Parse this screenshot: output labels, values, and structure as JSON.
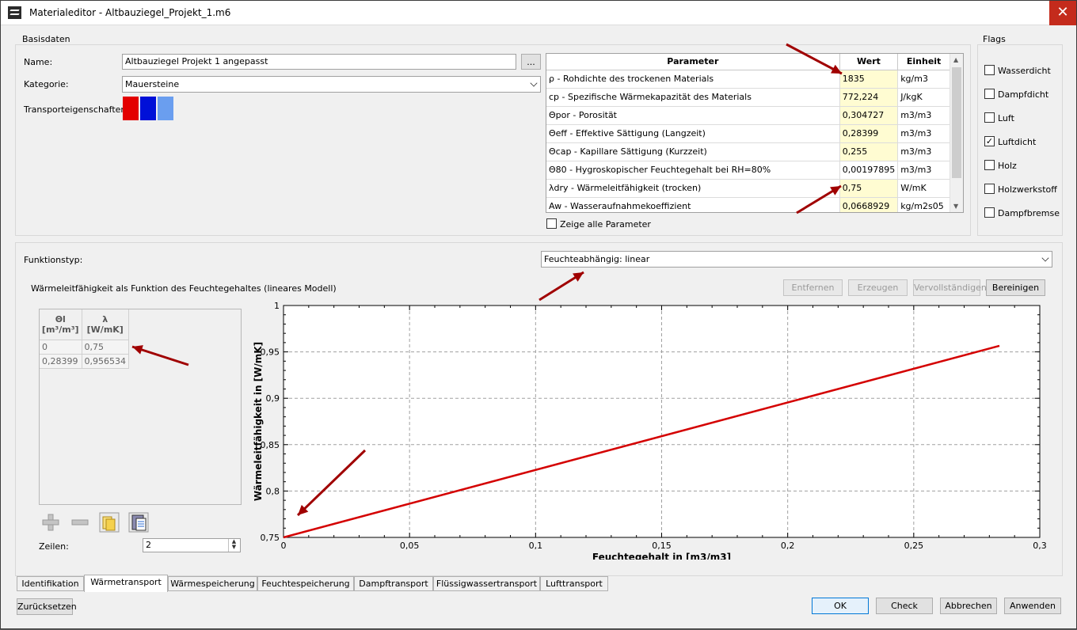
{
  "window": {
    "title": "Materialeditor - Altbauziegel_Projekt_1.m6",
    "close_glyph": "✕"
  },
  "basisdaten": {
    "group_label": "Basisdaten",
    "name_label": "Name:",
    "name_value": "Altbauziegel Projekt 1 angepasst",
    "browse_label": "...",
    "kategorie_label": "Kategorie:",
    "kategorie_value": "Mauersteine",
    "transport_label": "Transporteigenschaften:",
    "transport_colors": [
      "#e30000",
      "#0010d8",
      "#6a9eef"
    ]
  },
  "param_table": {
    "headers": {
      "param": "Parameter",
      "wert": "Wert",
      "einheit": "Einheit"
    },
    "rows": [
      {
        "param": "ρ - Rohdichte des trockenen Materials",
        "wert": "1835",
        "einheit": "kg/m3",
        "highlight": true
      },
      {
        "param": "cp - Spezifische Wärmekapazität des Materials",
        "wert": "772,224",
        "einheit": "J/kgK",
        "highlight": true
      },
      {
        "param": "Θpor - Porosität",
        "wert": "0,304727",
        "einheit": "m3/m3",
        "highlight": true
      },
      {
        "param": "Θeff - Effektive Sättigung (Langzeit)",
        "wert": "0,28399",
        "einheit": "m3/m3",
        "highlight": true
      },
      {
        "param": "Θcap - Kapillare Sättigung (Kurzzeit)",
        "wert": "0,255",
        "einheit": "m3/m3",
        "highlight": true
      },
      {
        "param": "Θ80 - Hygroskopischer Feuchtegehalt bei RH=80%",
        "wert": "0,00197895",
        "einheit": "m3/m3",
        "highlight": false
      },
      {
        "param": "λdry - Wärmeleitfähigkeit (trocken)",
        "wert": "0,75",
        "einheit": "W/mK",
        "highlight": true
      },
      {
        "param": "Aw - Wasseraufnahmekoeffizient",
        "wert": "0,0668929",
        "einheit": "kg/m2s05",
        "highlight": true
      }
    ],
    "show_all_label": "Zeige alle Parameter"
  },
  "flags": {
    "group_label": "Flags",
    "items": [
      {
        "label": "Wasserdicht",
        "checked": false
      },
      {
        "label": "Dampfdicht",
        "checked": false
      },
      {
        "label": "Luft",
        "checked": false
      },
      {
        "label": "Luftdicht",
        "checked": true
      },
      {
        "label": "Holz",
        "checked": false
      },
      {
        "label": "Holzwerkstoff",
        "checked": false
      },
      {
        "label": "Dampfbremse",
        "checked": false
      }
    ]
  },
  "function": {
    "typ_label": "Funktionstyp:",
    "typ_value": "Feuchteabhängig: linear",
    "description": "Wärmeleitfähigkeit als Funktion des Feuchtegehaltes (lineares Modell)",
    "buttons": {
      "entfernen": "Entfernen",
      "erzeugen": "Erzeugen",
      "vervollstaendigen": "Vervollständigen",
      "bereinigen": "Bereinigen"
    },
    "table_headers": [
      {
        "line1": "Θl",
        "line2": "[m³/m³]"
      },
      {
        "line1": "λ",
        "line2": "[W/mK]"
      }
    ],
    "table_rows": [
      [
        "0",
        "0,75"
      ],
      [
        "0,28399",
        "0,956534"
      ]
    ],
    "zeilen_label": "Zeilen:",
    "zeilen_value": "2"
  },
  "chart_data": {
    "type": "line",
    "xlabel": "Feuchtegehalt in [m3/m3]",
    "ylabel": "Wärmeleitfähigkeit in [W/mK]",
    "xlim": [
      0,
      0.3
    ],
    "ylim": [
      0.75,
      1
    ],
    "x_ticks": [
      "0",
      "0,05",
      "0,1",
      "0,15",
      "0,2",
      "0,25",
      "0,3"
    ],
    "y_ticks": [
      "0,75",
      "0,8",
      "0,85",
      "0,9",
      "0,95",
      "1"
    ],
    "x_tick_values": [
      0,
      0.05,
      0.1,
      0.15,
      0.2,
      0.25,
      0.3
    ],
    "y_tick_values": [
      0.75,
      0.8,
      0.85,
      0.9,
      0.95,
      1
    ],
    "grid": true,
    "series": [
      {
        "x": [
          0,
          0.28399
        ],
        "y": [
          0.75,
          0.956534
        ],
        "color": "#d40000"
      }
    ]
  },
  "tabs": [
    "Identifikation",
    "Wärmetransport",
    "Wärmespeicherung",
    "Feuchtespeicherung",
    "Dampftransport",
    "Flüssigwassertransport",
    "Lufttransport"
  ],
  "active_tab": "Wärmetransport",
  "footer": {
    "reset": "Zurücksetzen",
    "ok": "OK",
    "check": "Check",
    "cancel": "Abbrechen",
    "apply": "Anwenden"
  },
  "arrow_color": "#a00000"
}
